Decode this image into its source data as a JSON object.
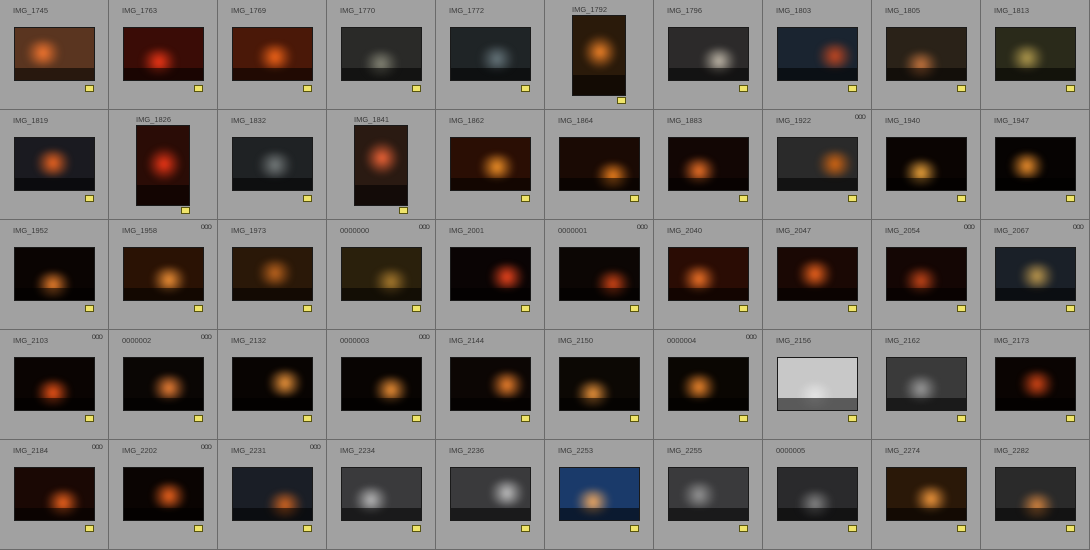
{
  "grid": {
    "columns": 10,
    "rows": [
      [
        {
          "name": "IMG_1745",
          "orient": "landscape",
          "bg": "#5a3520",
          "glow": "#ff7a30",
          "badge": false
        },
        {
          "name": "IMG_1763",
          "orient": "landscape",
          "bg": "#3a0c06",
          "glow": "#ff3a18",
          "badge": false
        },
        {
          "name": "IMG_1769",
          "orient": "landscape",
          "bg": "#4a1808",
          "glow": "#ff6a1a",
          "badge": false
        },
        {
          "name": "IMG_1770",
          "orient": "landscape",
          "bg": "#2a2a28",
          "glow": "#8a8a7a",
          "badge": false
        },
        {
          "name": "IMG_1772",
          "orient": "landscape",
          "bg": "#1f2426",
          "glow": "#6a7a80",
          "badge": false
        },
        {
          "name": "IMG_1792",
          "orient": "portrait",
          "bg": "#2a1a0a",
          "glow": "#ff8a2a",
          "badge": false
        },
        {
          "name": "IMG_1796",
          "orient": "landscape",
          "bg": "#2c2a2a",
          "glow": "#c8c0b0",
          "badge": false
        },
        {
          "name": "IMG_1803",
          "orient": "landscape",
          "bg": "#1a2430",
          "glow": "#d04a20",
          "badge": false
        },
        {
          "name": "IMG_1805",
          "orient": "landscape",
          "bg": "#2a2218",
          "glow": "#d07a40",
          "badge": false
        },
        {
          "name": "IMG_1813",
          "orient": "landscape",
          "bg": "#2a2a1a",
          "glow": "#b8a050",
          "badge": false
        }
      ],
      [
        {
          "name": "IMG_1819",
          "orient": "landscape",
          "bg": "#1a1a20",
          "glow": "#ff6a20",
          "badge": false
        },
        {
          "name": "IMG_1826",
          "orient": "portrait",
          "bg": "#2a0c06",
          "glow": "#ff3a18",
          "badge": false
        },
        {
          "name": "IMG_1832",
          "orient": "landscape",
          "bg": "#1f2224",
          "glow": "#7a8080",
          "badge": false
        },
        {
          "name": "IMG_1841",
          "orient": "portrait",
          "bg": "#2a1a12",
          "glow": "#ff6a3a",
          "badge": false
        },
        {
          "name": "IMG_1862",
          "orient": "landscape",
          "bg": "#2a0e04",
          "glow": "#ff9a2a",
          "badge": false
        },
        {
          "name": "IMG_1864",
          "orient": "landscape",
          "bg": "#1a0a04",
          "glow": "#ff8a20",
          "badge": false
        },
        {
          "name": "IMG_1883",
          "orient": "landscape",
          "bg": "#120604",
          "glow": "#ff7a2a",
          "badge": false
        },
        {
          "name": "IMG_1922",
          "orient": "landscape",
          "bg": "#2a2a2a",
          "glow": "#e06a10",
          "badge": true
        },
        {
          "name": "IMG_1940",
          "orient": "landscape",
          "bg": "#0a0402",
          "glow": "#ffb040",
          "badge": false
        },
        {
          "name": "IMG_1947",
          "orient": "landscape",
          "bg": "#060302",
          "glow": "#ff9a30",
          "badge": false
        }
      ],
      [
        {
          "name": "IMG_1952",
          "orient": "landscape",
          "bg": "#0a0402",
          "glow": "#ff8a30",
          "badge": false
        },
        {
          "name": "IMG_1958",
          "orient": "landscape",
          "bg": "#2a1204",
          "glow": "#ff9a3a",
          "badge": true
        },
        {
          "name": "IMG_1973",
          "orient": "landscape",
          "bg": "#2a1808",
          "glow": "#c86a20",
          "badge": false
        },
        {
          "name": "0000000",
          "orient": "landscape",
          "bg": "#2a200c",
          "glow": "#b08030",
          "badge": true
        },
        {
          "name": "IMG_2001",
          "orient": "landscape",
          "bg": "#0a0404",
          "glow": "#ff4a20",
          "badge": false
        },
        {
          "name": "0000001",
          "orient": "landscape",
          "bg": "#0c0604",
          "glow": "#e04a18",
          "badge": true
        },
        {
          "name": "IMG_2040",
          "orient": "landscape",
          "bg": "#2a0c04",
          "glow": "#ff7a2a",
          "badge": false
        },
        {
          "name": "IMG_2047",
          "orient": "landscape",
          "bg": "#1a0804",
          "glow": "#ff6a20",
          "badge": false
        },
        {
          "name": "IMG_2054",
          "orient": "landscape",
          "bg": "#140604",
          "glow": "#d04a1a",
          "badge": true
        },
        {
          "name": "IMG_2067",
          "orient": "landscape",
          "bg": "#1a2028",
          "glow": "#c8a050",
          "badge": true
        }
      ],
      [
        {
          "name": "IMG_2103",
          "orient": "landscape",
          "bg": "#0a0402",
          "glow": "#ff5a1a",
          "badge": true
        },
        {
          "name": "0000002",
          "orient": "landscape",
          "bg": "#0a0604",
          "glow": "#ff8a3a",
          "badge": true
        },
        {
          "name": "IMG_2132",
          "orient": "landscape",
          "bg": "#080402",
          "glow": "#ffa040",
          "badge": false
        },
        {
          "name": "0000003",
          "orient": "landscape",
          "bg": "#080402",
          "glow": "#ff9a3a",
          "badge": true
        },
        {
          "name": "IMG_2144",
          "orient": "landscape",
          "bg": "#0c0604",
          "glow": "#ff8a30",
          "badge": false
        },
        {
          "name": "IMG_2150",
          "orient": "landscape",
          "bg": "#0c0804",
          "glow": "#ffa040",
          "badge": false
        },
        {
          "name": "0000004",
          "orient": "landscape",
          "bg": "#0a0602",
          "glow": "#ff9030",
          "badge": true
        },
        {
          "name": "IMG_2156",
          "orient": "landscape",
          "bg": "#c8c8c8",
          "glow": "#e8e8e8",
          "badge": false
        },
        {
          "name": "IMG_2162",
          "orient": "landscape",
          "bg": "#3a3a3a",
          "glow": "#a0a0a0",
          "badge": false
        },
        {
          "name": "IMG_2173",
          "orient": "landscape",
          "bg": "#0a0402",
          "glow": "#e04a18",
          "badge": false
        }
      ],
      [
        {
          "name": "IMG_2184",
          "orient": "landscape",
          "bg": "#1a0804",
          "glow": "#ff6a20",
          "badge": true
        },
        {
          "name": "IMG_2202",
          "orient": "landscape",
          "bg": "#0a0402",
          "glow": "#ff6a20",
          "badge": true
        },
        {
          "name": "IMG_2231",
          "orient": "landscape",
          "bg": "#1a1e26",
          "glow": "#e06a20",
          "badge": true
        },
        {
          "name": "IMG_2234",
          "orient": "landscape",
          "bg": "#3a3a3c",
          "glow": "#c0c0c0",
          "badge": false
        },
        {
          "name": "IMG_2236",
          "orient": "landscape",
          "bg": "#3a3a3c",
          "glow": "#c8c8c8",
          "badge": false
        },
        {
          "name": "IMG_2253",
          "orient": "landscape",
          "bg": "#1a3a6a",
          "glow": "#ffb060",
          "badge": false
        },
        {
          "name": "IMG_2255",
          "orient": "landscape",
          "bg": "#3a3a3c",
          "glow": "#9a9a9a",
          "badge": false
        },
        {
          "name": "0000005",
          "orient": "landscape",
          "bg": "#2a2a2c",
          "glow": "#8a8a8a",
          "badge": false
        },
        {
          "name": "IMG_2274",
          "orient": "landscape",
          "bg": "#2a1808",
          "glow": "#ffa040",
          "badge": false
        },
        {
          "name": "IMG_2282",
          "orient": "landscape",
          "bg": "#2a2a2a",
          "glow": "#e08a40",
          "badge": false
        }
      ]
    ],
    "badge_text": "ooo",
    "colors": {
      "cell_bg": "#a1a1a1",
      "grid_line": "#6a6a6a",
      "flag": "#efe46a"
    }
  }
}
